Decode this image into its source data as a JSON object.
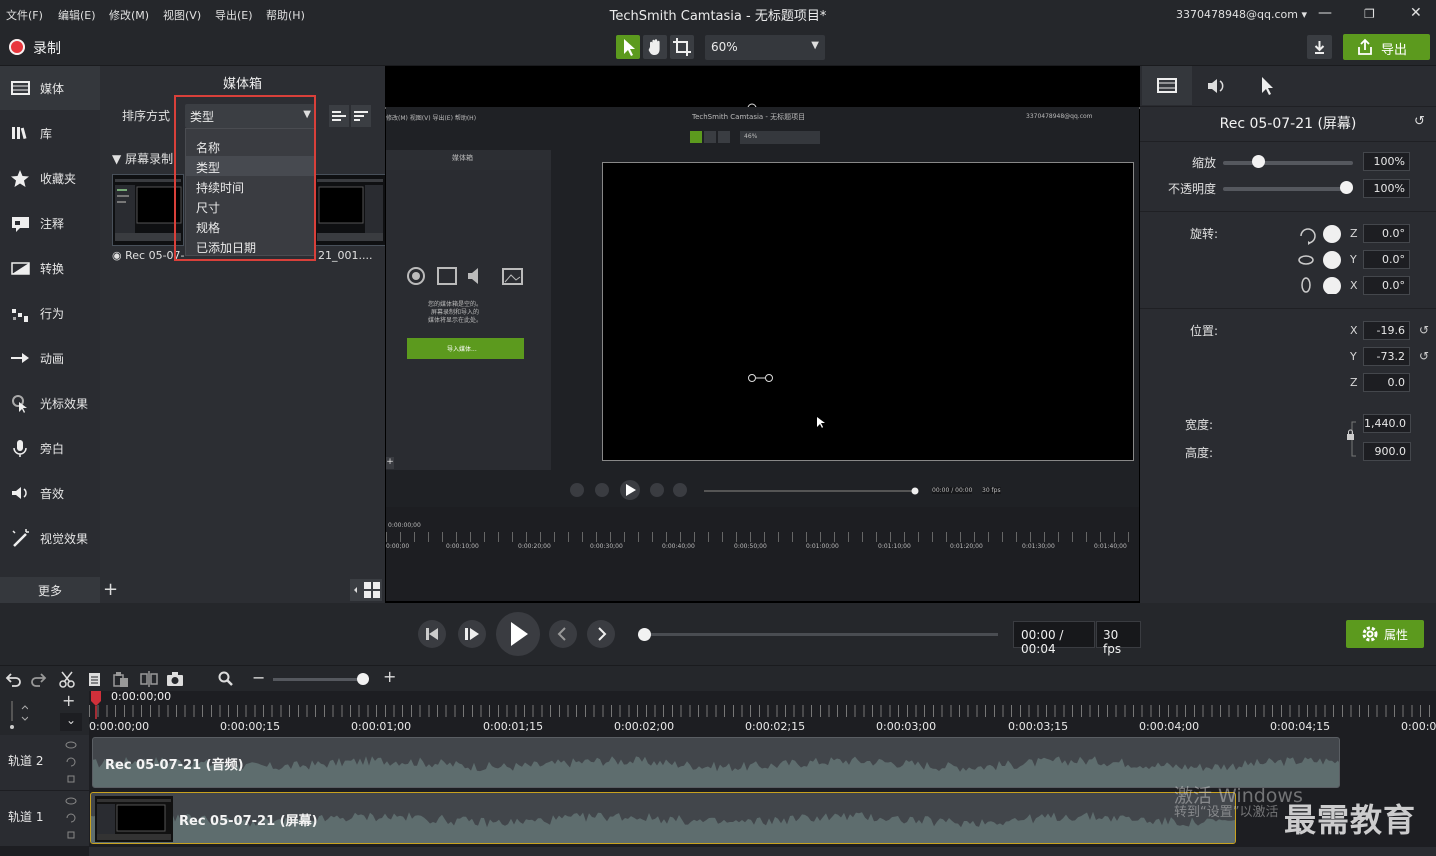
{
  "menubar": {
    "items": [
      "文件(F)",
      "编辑(E)",
      "修改(M)",
      "视图(V)",
      "导出(E)",
      "帮助(H)"
    ],
    "app_title": "TechSmith Camtasia - 无标题项目*",
    "account": "3370478948@qq.com"
  },
  "toolbar": {
    "record_label": "录制",
    "zoom_value": "60%",
    "export_label": "导出"
  },
  "colors": {
    "accent": "#5c9a1e",
    "record": "#e8363d",
    "highlight": "#d9403a"
  },
  "nav": {
    "items": [
      "媒体",
      "库",
      "收藏夹",
      "注释",
      "转换",
      "行为",
      "动画",
      "光标效果",
      "旁白",
      "音效",
      "视觉效果"
    ],
    "more_label": "更多"
  },
  "media_bin": {
    "title": "媒体箱",
    "sort_label": "排序方式",
    "sort_value": "类型",
    "group_label": "屏幕录制",
    "thumb1_label": "Rec 05-07-",
    "thumb2_label": "21_001....",
    "sort_options": [
      "名称",
      "类型",
      "持续时间",
      "尺寸",
      "规格",
      "已添加日期"
    ]
  },
  "canvas": {
    "inner_menu": "修改(M)  视图(V)  导出(E)  帮助(H)",
    "inner_title": "TechSmith Camtasia - 无标题项目",
    "inner_account": "3370478948@qq.com",
    "inner_zoom": "46%",
    "inner_bin_title": "媒体箱",
    "inner_empty_line1": "您的媒体箱是空的。",
    "inner_empty_line2": "屏幕录制和导入的",
    "inner_empty_line3": "媒体将显示在此处。",
    "inner_import": "导入媒体...",
    "inner_time": "00:00 / 00:00",
    "inner_fps": "30 fps",
    "inner_playhead": "0:00:00;00",
    "inner_ticks": [
      "0:00;00",
      "0:00:10;00",
      "0:00:20;00",
      "0:00:30;00",
      "0:00:40;00",
      "0:00:50;00",
      "0:01:00;00",
      "0:01:10;00",
      "0:01:20;00",
      "0:01:30;00",
      "0:01:40;00"
    ]
  },
  "properties": {
    "title": "Rec 05-07-21 (屏幕)",
    "scale_label": "缩放",
    "scale_value": "100%",
    "scale_fraction": 0.25,
    "opacity_label": "不透明度",
    "opacity_value": "100%",
    "opacity_fraction": 1.0,
    "rotation_label": "旋转:",
    "rot_z": "0.0°",
    "rot_y": "0.0°",
    "rot_x": "0.0°",
    "position_label": "位置:",
    "pos_x": "-19.6",
    "pos_y": "-73.2",
    "pos_z": "0.0",
    "width_label": "宽度:",
    "width_value": "1,440.0",
    "height_label": "高度:",
    "height_value": "900.0",
    "axis": {
      "x": "X",
      "y": "Y",
      "z": "Z"
    }
  },
  "playback": {
    "time": "00:00 / 00:04",
    "fps": "30 fps",
    "props_button": "属性"
  },
  "timeline": {
    "playhead_time": "0:00:00;00",
    "ticks": [
      "0:00:00;00",
      "0:00:00;15",
      "0:00:01;00",
      "0:00:01;15",
      "0:00:02;00",
      "0:00:02;15",
      "0:00:03;00",
      "0:00:03;15",
      "0:00:04;00",
      "0:00:04;15",
      "0:00:05"
    ],
    "tracks": [
      {
        "name": "轨道 2",
        "clip": "Rec 05-07-21 (音频)"
      },
      {
        "name": "轨道 1",
        "clip": "Rec 05-07-21 (屏幕)"
      }
    ]
  },
  "watermark": {
    "line1": "激活 Windows",
    "line2": "转到“设置”以激活",
    "brand": "最需教育"
  }
}
